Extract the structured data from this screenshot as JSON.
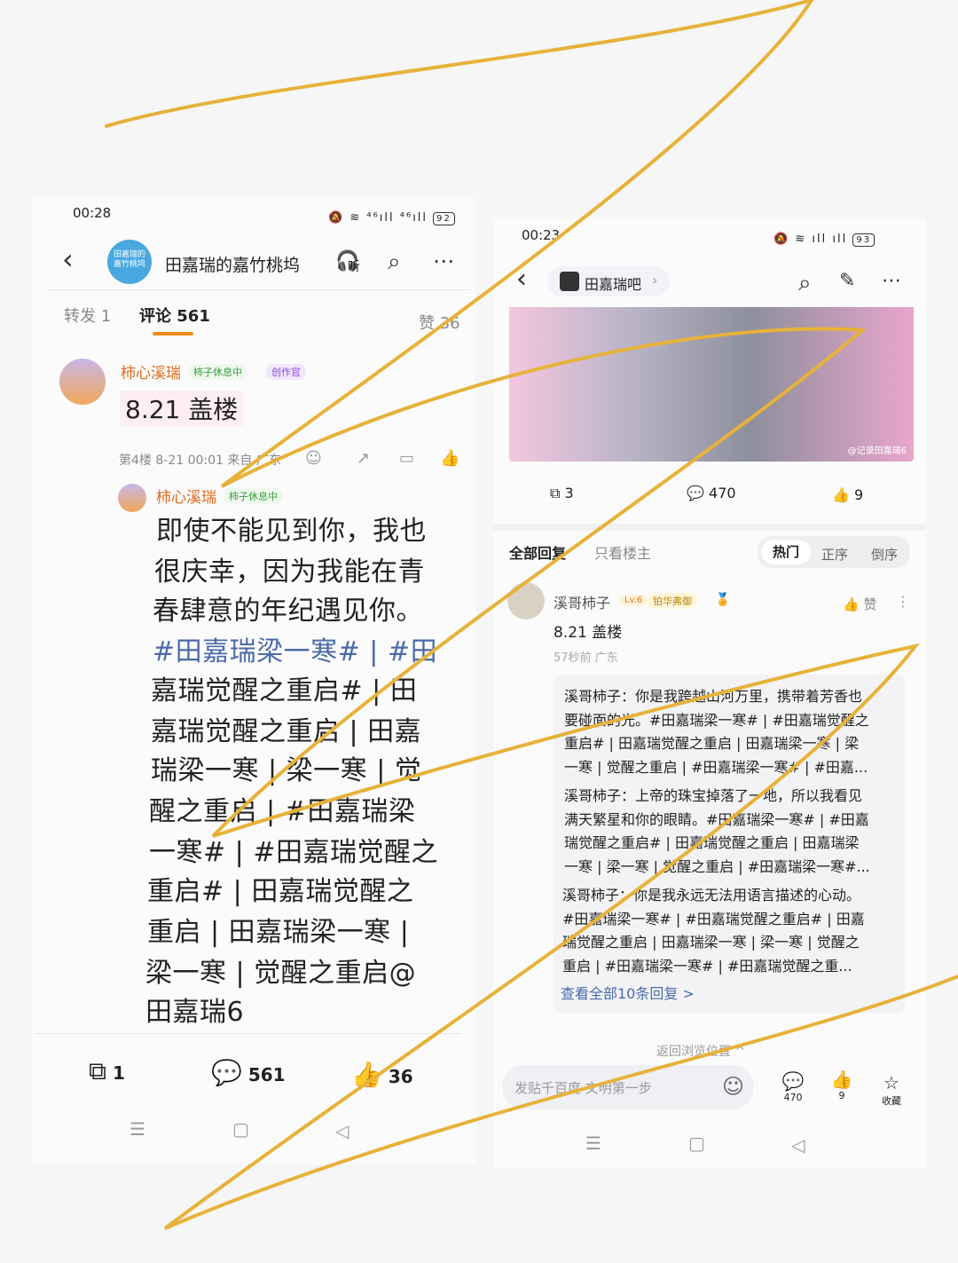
{
  "left_screen": {
    "status": {
      "time": "00:28",
      "battery": "92",
      "signal": "⁴⁶ıll ⁴⁶ıll"
    },
    "header": {
      "title": "田嘉瑞的嘉竹桃坞",
      "avatar_text": "田嘉瑞的\n嘉竹桃坞",
      "listen_label": "听"
    },
    "tabs": {
      "repost": "转发 1",
      "comments": "评论 561",
      "likes": "赞 36"
    },
    "comment": {
      "username": "柿心溪瑞",
      "badge1": "柿子休息中",
      "badge2": "创作官",
      "text": "8.21  盖楼",
      "meta": "第4楼 8-21 00:01  来自 广东"
    },
    "reply": {
      "username": "柿心溪瑞",
      "badge1": "柿子休息中",
      "lines": [
        "即使不能见到你，我也",
        "很庆幸，因为我能在青",
        "春肆意的年纪遇见你。",
        "#田嘉瑞梁一寒# | #田",
        "嘉瑞觉醒之重启# | 田",
        "嘉瑞觉醒之重启 | 田嘉",
        "瑞梁一寒 | 梁一寒 | 觉",
        "醒之重启 | #田嘉瑞梁",
        "一寒# | #田嘉瑞觉醒之",
        "重启# | 田嘉瑞觉醒之",
        "重启 | 田嘉瑞梁一寒 |",
        "梁一寒 | 觉醒之重启@",
        "田嘉瑞6"
      ]
    },
    "actions": {
      "repost": "1",
      "comments": "561",
      "likes": "36"
    }
  },
  "right_screen": {
    "status": {
      "time": "00:23",
      "battery": "93"
    },
    "header": {
      "title": "田嘉瑞吧"
    },
    "image_watermark": "@记录田嘉瑞6",
    "post_actions": {
      "repost": "3",
      "comments": "470",
      "likes": "9"
    },
    "filters": {
      "all": "全部回复",
      "host": "只看楼主",
      "hot": "热门",
      "asc": "正序",
      "desc": "倒序"
    },
    "floor": {
      "username": "溪哥柿子",
      "level": "Lv.6",
      "badge": "铂华弗御",
      "like": "赞",
      "text": "8.21 盖楼",
      "meta": "57秒前 广东"
    },
    "replies": [
      [
        "溪哥柿子：你是我跨越山河万里，携带着芳香也",
        "要碰面的光。#田嘉瑞梁一寒# | #田嘉瑞觉醒之",
        "重启# | 田嘉瑞觉醒之重启 | 田嘉瑞梁一寒 | 梁",
        "一寒 | 觉醒之重启 | #田嘉瑞梁一寒# | #田嘉..."
      ],
      [
        "溪哥柿子：上帝的珠宝掉落了一地，所以我看见",
        "满天繁星和你的眼睛。#田嘉瑞梁一寒# | #田嘉",
        "瑞觉醒之重启# | 田嘉瑞觉醒之重启 | 田嘉瑞梁",
        "一寒 | 梁一寒 | 觉醒之重启 | #田嘉瑞梁一寒#..."
      ],
      [
        "溪哥柿子：你是我永远无法用语言描述的心动。",
        "#田嘉瑞梁一寒# | #田嘉瑞觉醒之重启# | 田嘉",
        "瑞觉醒之重启 | 田嘉瑞梁一寒 | 梁一寒 | 觉醒之",
        "重启 | #田嘉瑞梁一寒# | #田嘉瑞觉醒之重..."
      ]
    ],
    "view_all": "查看全部10条回复 >",
    "return_pos": "返回浏览位置 ^",
    "input_placeholder": "发贴千百度 文明第一步",
    "bottom": {
      "comments": "470",
      "likes": "9",
      "favorite": "收藏"
    }
  },
  "colors": {
    "accent_orange": "#e36a1e",
    "link_blue": "#4a6aa8",
    "scribble": "#e7b23a"
  }
}
